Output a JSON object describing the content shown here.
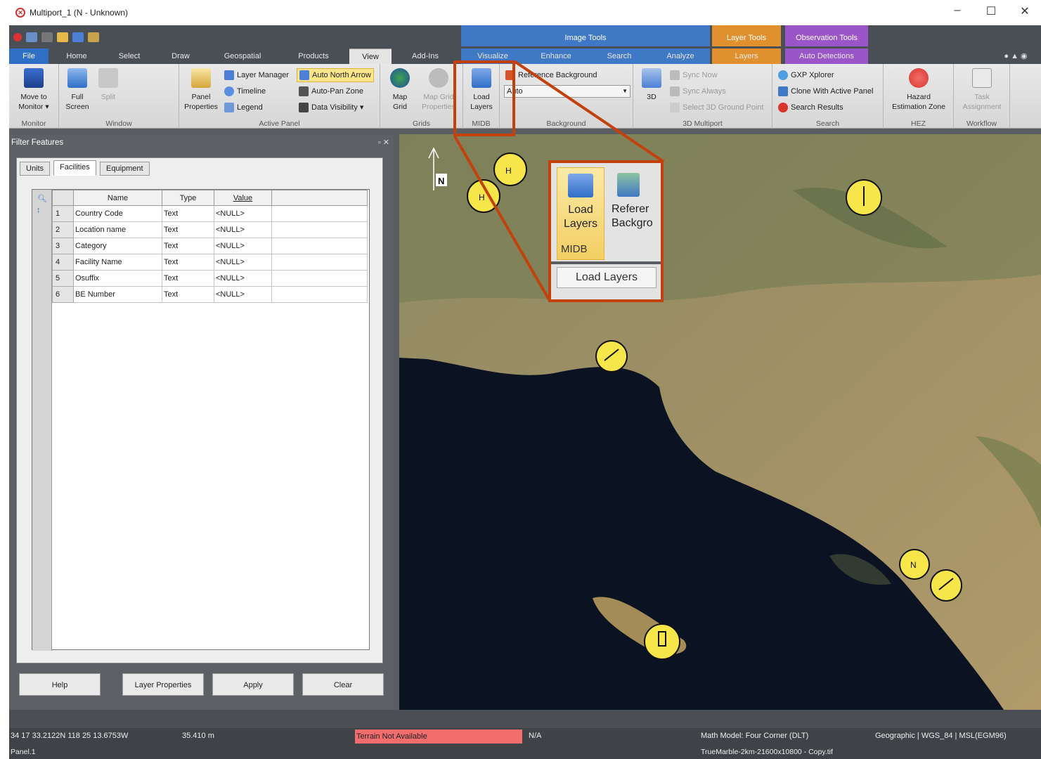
{
  "window": {
    "title": "Multiport_1 (N - Unknown)",
    "minimize": "–",
    "maximize": "☐",
    "close": "✕"
  },
  "context_groups": {
    "image_tools": "Image Tools",
    "layer_tools": "Layer Tools",
    "observation_tools": "Observation Tools"
  },
  "tabs": [
    "File",
    "Home",
    "Select",
    "Draw",
    "Geospatial",
    "Products",
    "View",
    "Add-Ins",
    "Visualize",
    "Enhance",
    "Search",
    "Analyze",
    "Layers",
    "Auto Detections"
  ],
  "active_tab": "View",
  "ribbon": {
    "monitor": {
      "label": "Monitor",
      "move_to_monitor_1": "Move to",
      "move_to_monitor_2": "Monitor ▾"
    },
    "window": {
      "label": "Window",
      "full_screen_1": "Full",
      "full_screen_2": "Screen",
      "split": "Split"
    },
    "active_panel": {
      "label": "Active Panel",
      "panel_properties_1": "Panel",
      "panel_properties_2": "Properties",
      "layer_manager": "Layer Manager",
      "timeline": "Timeline",
      "legend": "Legend",
      "auto_north_arrow": "Auto North Arrow",
      "auto_pan_zone": "Auto-Pan Zone",
      "data_visibility": "Data Visibility ▾"
    },
    "grids": {
      "label": "Grids",
      "map_grid_1": "Map",
      "map_grid_2": "Grid",
      "map_grid_properties_1": "Map Grid",
      "map_grid_properties_2": "Properties"
    },
    "midb": {
      "label": "MIDB",
      "load_layers_1": "Load",
      "load_layers_2": "Layers"
    },
    "background": {
      "label": "Background",
      "reference_background": "Reference Background",
      "dropdown_value": "Auto"
    },
    "multiport3d": {
      "label": "3D Multiport",
      "threed": "3D",
      "sync_now": "Sync Now",
      "sync_always": "Sync Always",
      "select_ground_point": "Select 3D Ground Point"
    },
    "search": {
      "label": "Search",
      "gxp_xplorer": "GXP Xplorer",
      "clone_with_active_panel": "Clone With Active Panel",
      "search_results": "Search Results"
    },
    "hez": {
      "label": "HEZ",
      "hazard_1": "Hazard",
      "hazard_2": "Estimation Zone"
    },
    "workflow": {
      "label": "Workflow",
      "task_1": "Task",
      "task_2": "Assignment"
    }
  },
  "filter_panel": {
    "title": "Filter Features",
    "tabs": [
      "Units",
      "Facilities",
      "Equipment"
    ],
    "active_tab": "Facilities",
    "columns": [
      "Name",
      "Type",
      "Value"
    ],
    "rows": [
      {
        "num": "1",
        "name": "Country Code",
        "type": "Text",
        "value": "<NULL>"
      },
      {
        "num": "2",
        "name": "Location name",
        "type": "Text",
        "value": "<NULL>"
      },
      {
        "num": "3",
        "name": "Category",
        "type": "Text",
        "value": "<NULL>"
      },
      {
        "num": "4",
        "name": "Facility Name",
        "type": "Text",
        "value": "<NULL>"
      },
      {
        "num": "5",
        "name": "Osuffix",
        "type": "Text",
        "value": "<NULL>"
      },
      {
        "num": "6",
        "name": "BE Number",
        "type": "Text",
        "value": "<NULL>"
      }
    ],
    "buttons": {
      "help": "Help",
      "layer_properties": "Layer Properties",
      "apply": "Apply",
      "clear": "Clear"
    }
  },
  "map": {
    "north_label": "N",
    "zoom_callout": {
      "load_1": "Load",
      "load_2": "Layers",
      "ref_1": "Referer",
      "ref_2": "Backgro",
      "group": "MIDB",
      "tooltip": "Load Layers"
    }
  },
  "status": {
    "coordinates": "34 17 33.2122N 118 25 13.6753W",
    "elevation": "35.410  m",
    "terrain": "Terrain Not Available",
    "na": "N/A",
    "math_model": "Math Model: Four Corner (DLT)",
    "projection": "Geographic | WGS_84 | MSL(EGM96)",
    "panel": "Panel.1",
    "file": "TrueMarble-2km-21600x10800 - Copy.tif"
  },
  "colors": {
    "accent": "#2f6fc6",
    "callout": "#c2410c",
    "terrain_warning": "#f26d6d",
    "highlight": "#fbe58a",
    "marker": "#f7e64a"
  }
}
